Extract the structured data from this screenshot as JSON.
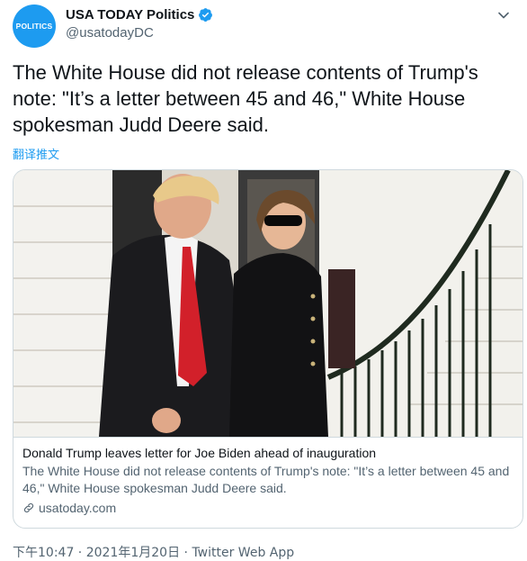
{
  "account": {
    "avatar_text": "POLITICS",
    "display_name": "USA TODAY Politics",
    "handle": "@usatodayDC",
    "verified": true
  },
  "tweet": {
    "text": "The White House did not release contents of Trump's note: \"It’s a letter between 45 and 46,\" White House spokesman Judd Deere said.",
    "translate_label": "翻译推文"
  },
  "card": {
    "title": "Donald Trump leaves letter for Joe Biden ahead of inauguration",
    "description": "The White House did not release contents of Trump's note: \"It’s a letter between 45 and 46,\" White House spokesman Judd Deere said.",
    "domain": "usatoday.com"
  },
  "meta": {
    "time": "下午10:47",
    "separator": " · ",
    "date": "2021年1月20日",
    "source": "Twitter Web App"
  },
  "icons": {
    "verified": "verified-badge-icon",
    "more": "chevron-down-icon",
    "link": "link-icon"
  },
  "colors": {
    "accent": "#1d9bf0",
    "secondary_text": "#536471",
    "border": "#cfd9de"
  }
}
